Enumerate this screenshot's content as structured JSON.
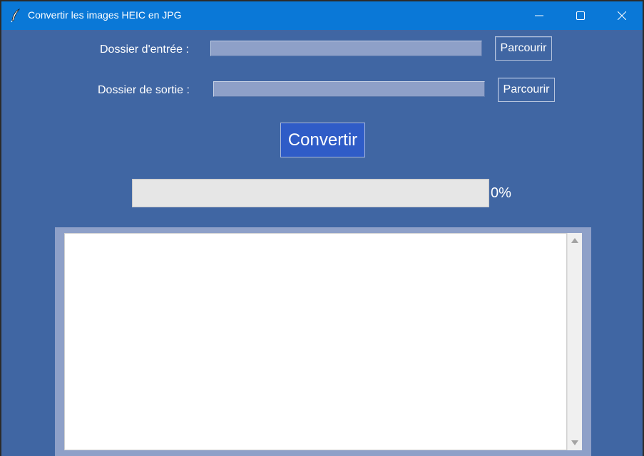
{
  "window": {
    "title": "Convertir les images HEIC en JPG",
    "icons": {
      "app": "feather-icon",
      "minimize": "minimize-icon",
      "maximize": "maximize-icon",
      "close": "close-icon"
    }
  },
  "form": {
    "input_label": "Dossier d'entrée :",
    "input_value": "",
    "output_label": "Dossier de sortie :",
    "output_value": "",
    "browse_input_label": "Parcourir",
    "browse_output_label": "Parcourir"
  },
  "convert": {
    "label": "Convertir"
  },
  "progress": {
    "value": 0,
    "text": "0%"
  },
  "log": {
    "content": ""
  },
  "colors": {
    "background": "#4066a3",
    "titlebar": "#0a78d7",
    "entry": "#8ea0c8",
    "convert_button": "#2f5cc7"
  }
}
